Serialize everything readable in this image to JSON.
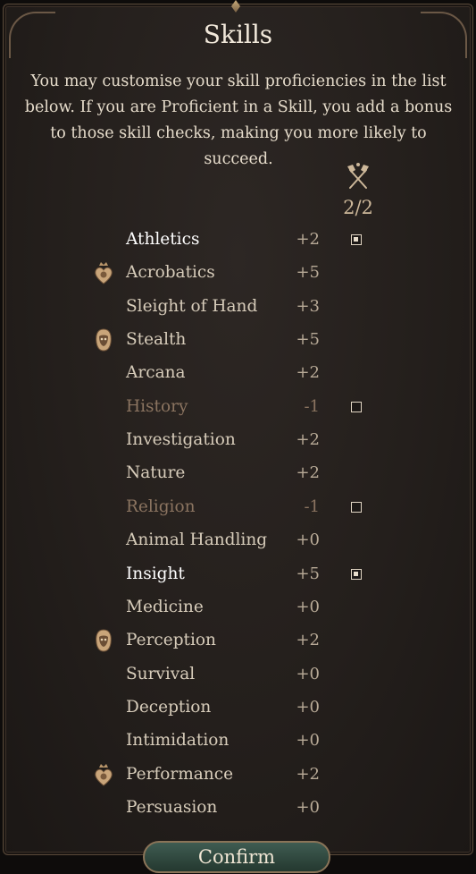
{
  "window": {
    "title": "Skills",
    "description": "You may customise your skill proficiencies in the list below. If you are Proficient in a Skill, you add a bonus to those skill checks, making you more likely to succeed."
  },
  "proficiency": {
    "icon": "crossed-axes-icon",
    "count": "2/2"
  },
  "skills": [
    {
      "name": "Athletics",
      "bonus": "+2",
      "state": "proficient",
      "checkbox": "checked",
      "icon": ""
    },
    {
      "name": "Acrobatics",
      "bonus": "+5",
      "state": "normal",
      "checkbox": "",
      "icon": "heart-crown-icon"
    },
    {
      "name": "Sleight of Hand",
      "bonus": "+3",
      "state": "normal",
      "checkbox": "",
      "icon": ""
    },
    {
      "name": "Stealth",
      "bonus": "+5",
      "state": "normal",
      "checkbox": "",
      "icon": "hooded-mask-icon"
    },
    {
      "name": "Arcana",
      "bonus": "+2",
      "state": "normal",
      "checkbox": "",
      "icon": ""
    },
    {
      "name": "History",
      "bonus": "-1",
      "state": "dim",
      "checkbox": "unchecked",
      "icon": ""
    },
    {
      "name": "Investigation",
      "bonus": "+2",
      "state": "normal",
      "checkbox": "",
      "icon": ""
    },
    {
      "name": "Nature",
      "bonus": "+2",
      "state": "normal",
      "checkbox": "",
      "icon": ""
    },
    {
      "name": "Religion",
      "bonus": "-1",
      "state": "dim",
      "checkbox": "unchecked",
      "icon": ""
    },
    {
      "name": "Animal Handling",
      "bonus": "+0",
      "state": "normal",
      "checkbox": "",
      "icon": ""
    },
    {
      "name": "Insight",
      "bonus": "+5",
      "state": "proficient",
      "checkbox": "checked",
      "icon": ""
    },
    {
      "name": "Medicine",
      "bonus": "+0",
      "state": "normal",
      "checkbox": "",
      "icon": ""
    },
    {
      "name": "Perception",
      "bonus": "+2",
      "state": "normal",
      "checkbox": "",
      "icon": "hooded-mask-icon"
    },
    {
      "name": "Survival",
      "bonus": "+0",
      "state": "normal",
      "checkbox": "",
      "icon": ""
    },
    {
      "name": "Deception",
      "bonus": "+0",
      "state": "normal",
      "checkbox": "",
      "icon": ""
    },
    {
      "name": "Intimidation",
      "bonus": "+0",
      "state": "normal",
      "checkbox": "",
      "icon": ""
    },
    {
      "name": "Performance",
      "bonus": "+2",
      "state": "normal",
      "checkbox": "",
      "icon": "heart-crown-icon"
    },
    {
      "name": "Persuasion",
      "bonus": "+0",
      "state": "normal",
      "checkbox": "",
      "icon": ""
    }
  ],
  "confirm_label": "Confirm",
  "colors": {
    "panel_bg": "#241f1c",
    "text_normal": "#d7ccba",
    "text_proficient": "#ffffff",
    "text_dim": "#8b7460",
    "confirm_bg": "#2f4a40",
    "icon_gold": "#c9ab7a"
  }
}
